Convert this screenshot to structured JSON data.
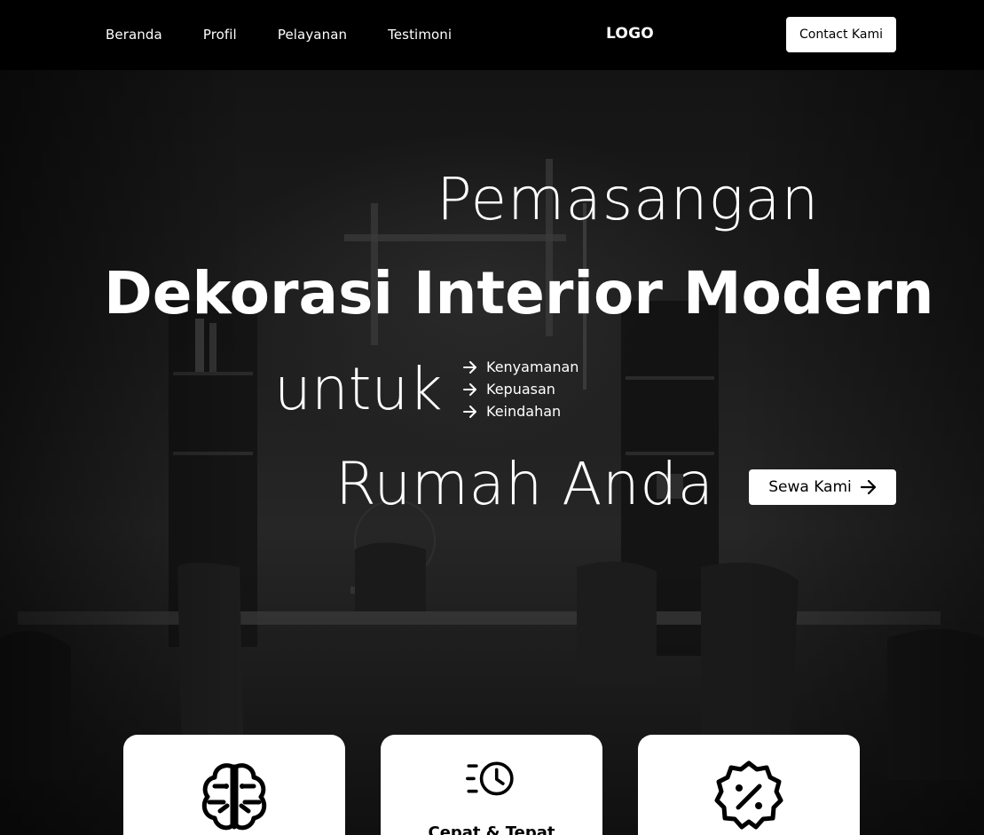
{
  "nav": {
    "links": [
      "Beranda",
      "Profil",
      "Pelayanan",
      "Testimoni"
    ],
    "logo": "LOGO",
    "contact_label": "Contact Kami"
  },
  "hero": {
    "line1": "Pemasangan",
    "line2": "Dekorasi Interior Modern",
    "line3": "untuk",
    "line4": "Rumah Anda",
    "benefits": [
      "Kenyamanan",
      "Kepuasan",
      "Keindahan"
    ],
    "cta_label": "Sewa Kami"
  },
  "features": [
    {
      "icon": "brain-icon",
      "title": ""
    },
    {
      "icon": "fast-clock-icon",
      "title": "Cepat & Tepat"
    },
    {
      "icon": "discount-badge-icon",
      "title": ""
    }
  ],
  "colors": {
    "navbar_bg": "#000000",
    "hero_overlay": "#1a1a1a",
    "button_bg": "#ffffff",
    "text_light": "#ffffff",
    "text_dark": "#000000"
  }
}
